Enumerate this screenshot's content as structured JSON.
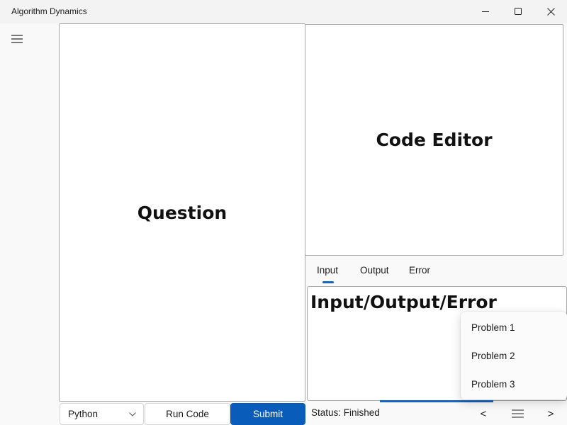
{
  "window": {
    "title": "Algorithm Dynamics",
    "controls": {
      "minimize": "minimize-icon",
      "maximize": "maximize-icon",
      "close": "close-icon"
    }
  },
  "nav": {
    "menu_icon": "hamburger-menu-icon"
  },
  "panels": {
    "question": "Question",
    "editor": "Code Editor",
    "io": "Input/Output/Error"
  },
  "io_tabs": [
    {
      "label": "Input",
      "selected": true
    },
    {
      "label": "Output",
      "selected": false
    },
    {
      "label": "Error",
      "selected": false
    }
  ],
  "toolbar": {
    "language": "Python",
    "run_label": "Run Code",
    "submit_label": "Submit"
  },
  "status": {
    "text": "Status: Finished"
  },
  "problem_nav": {
    "prev_label": "<",
    "next_label": ">",
    "list_icon": "list-icon",
    "menu_items": [
      "Problem 1",
      "Problem 2",
      "Problem 3"
    ]
  },
  "colors": {
    "accent": "#0a5cba",
    "indicator": "#1565c0"
  }
}
